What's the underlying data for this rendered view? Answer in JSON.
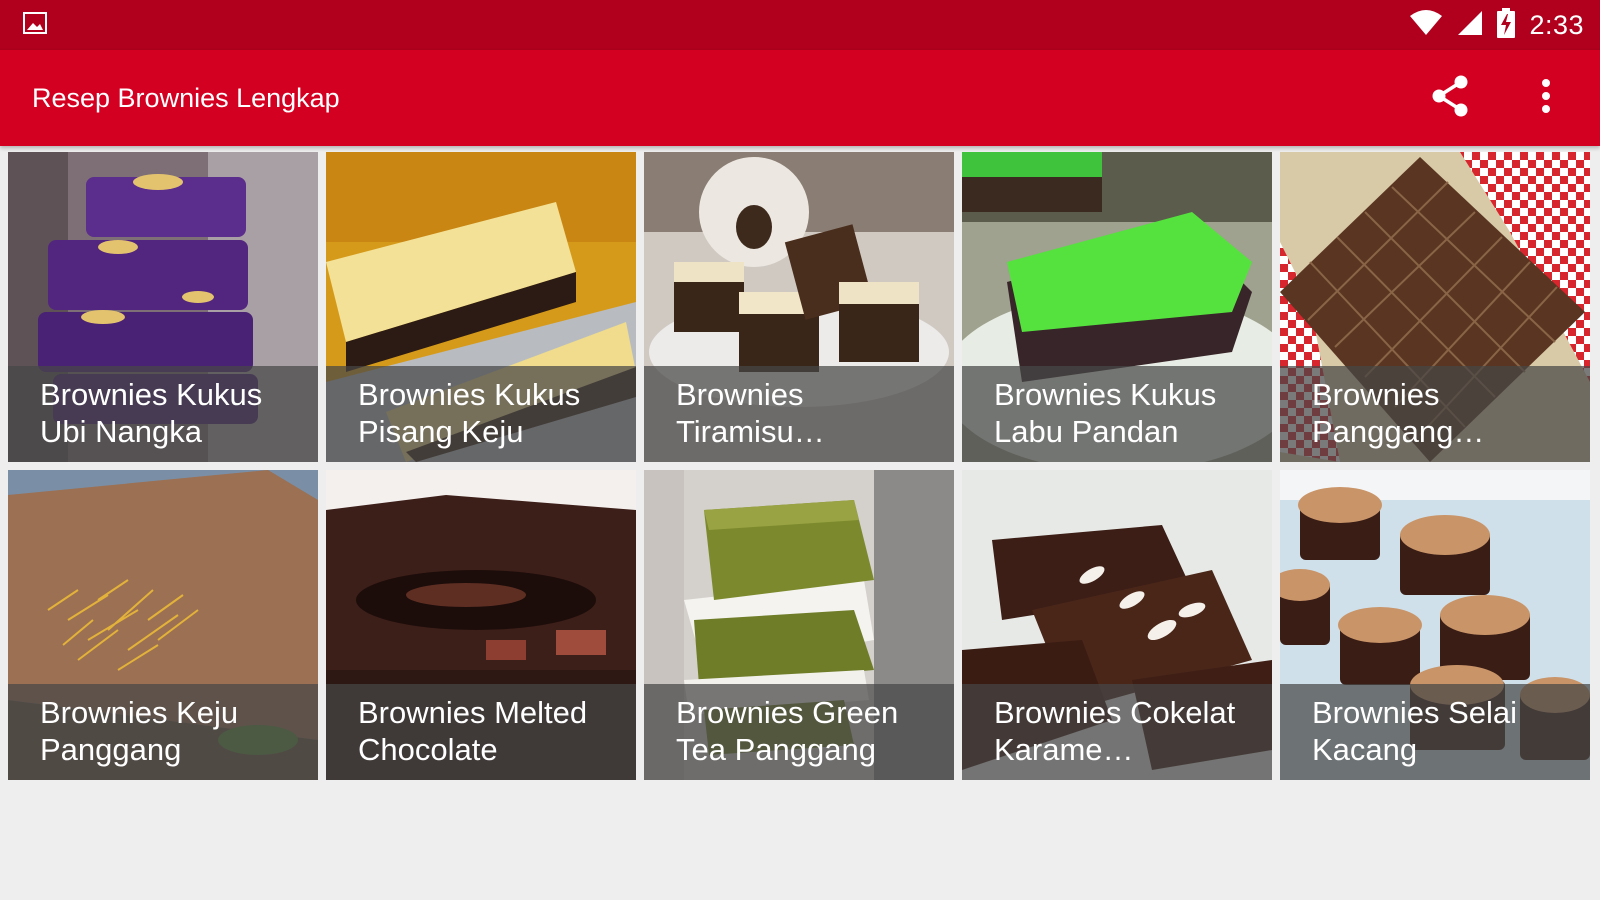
{
  "status_bar": {
    "time": "2:33",
    "icons": [
      "gallery-notification-icon",
      "wifi-icon",
      "cell-signal-icon",
      "battery-charging-icon"
    ]
  },
  "app_bar": {
    "title": "Resep Brownies Lengkap",
    "actions": [
      "share-icon",
      "more-vert-icon"
    ]
  },
  "recipes": [
    {
      "title": "Brownies Kukus Ubi Nangka",
      "display": "Brownies Kukus Ubi Nangka"
    },
    {
      "title": "Brownies Kukus Pisang Keju",
      "display": "Brownies Kukus Pisang Keju"
    },
    {
      "title": "Brownies Tiramisu…",
      "display": "Brownies Tiramisu…"
    },
    {
      "title": "Brownies Kukus Labu Pandan",
      "display": "Brownies Kukus Labu Pandan"
    },
    {
      "title": "Brownies Panggang…",
      "display": "Brownies Panggang…"
    },
    {
      "title": "Brownies Keju Panggang",
      "display": "Brownies Keju Panggang"
    },
    {
      "title": "Brownies Melted Chocolate",
      "display": "Brownies Melted Chocolate"
    },
    {
      "title": "Brownies Green Tea Panggang",
      "display": "Brownies Green Tea Panggang"
    },
    {
      "title": "Brownies Cokelat Karame…",
      "display": "Brownies Cokelat Karame…"
    },
    {
      "title": "Brownies Selai Kacang",
      "display": "Brownies Selai Kacang"
    }
  ],
  "colors": {
    "status_bar": "#b0001e",
    "app_bar": "#d40021",
    "background": "#eeeeee"
  }
}
